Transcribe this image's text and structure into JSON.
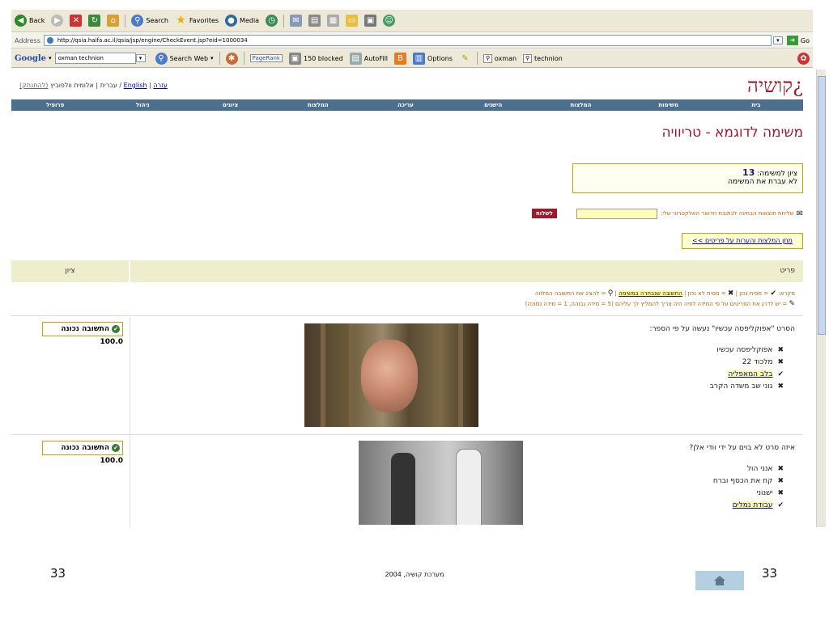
{
  "browser": {
    "back": "Back",
    "search": "Search",
    "favorites": "Favorites",
    "media": "Media",
    "address_label": "Address",
    "url": "http://qsia.haifa.ac.il/qsia/jsp/engine/CheckEvent.jsp?eid=1000034",
    "go": "Go",
    "google": "Google",
    "google_query": "oxman technion",
    "search_web": "Search Web",
    "pagerank": "PageRank",
    "blocked": "150 blocked",
    "autofill": "AutoFill",
    "options": "Options",
    "q1": "oxman",
    "q2": "technion"
  },
  "site": {
    "logo": "¿קושיה",
    "help": "עזרה",
    "english": "English",
    "lang_rest": "/ עברית",
    "user": "אלומית וולפוביץ",
    "logout": "(להתנתק)"
  },
  "nav": [
    "בית",
    "משימות",
    "המלצות",
    "הישגים",
    "עריכה",
    "המלצות",
    "ציונים",
    "ניהול",
    "פרופיל"
  ],
  "task": {
    "title": "משימה לדוגמא - טריוויה",
    "grade_label": "ציון למשימה:",
    "grade_value": "13",
    "status": "לא עברת את המשימה",
    "email_label": "שליחת תוצאות הבחינה לכתובת הדואר האלקטרוני שלי:",
    "send": "לשלוח",
    "recommend_link": "מתן המלצות והערות על פריטים >>"
  },
  "table": {
    "col_item": "פריט",
    "col_score": "ציון",
    "legend_1a": "מקרא:",
    "legend_1b": "= מסיח נכון |",
    "legend_1c": "= מסיח לא נכון |",
    "legend_1d": "התשובה שנבחרה במשימה",
    "legend_1e": "| ",
    "legend_1f": "= להציג את התשובה המלווה",
    "legend_2": "= יש לדרג את הפריטים על פי המידה לפיה היה צריך להמליץ לך עליהם (5 = מידה גבוהה, 1 = מידה נמוכה)"
  },
  "questions": [
    {
      "text": "הסרט \"אפוקליפסה עכשיו\" נעשה על פי הספר:",
      "options": [
        "אפוקליפסה עכשיו",
        "מלכוד 22",
        "בלב המאפליה",
        "גוני שב משדה הקרב"
      ],
      "marks": [
        "✖",
        "✖",
        "✔",
        "✖"
      ],
      "result": "התשובה נכונה",
      "score": "100.0"
    },
    {
      "text": "איזה סרט לא בוים על ידי וודי אלן?",
      "options": [
        "אנני הול",
        "קח את הכסף וברח",
        "ישנוני",
        "עבודת נמלים"
      ],
      "marks": [
        "✖",
        "✖",
        "✖",
        "✔"
      ],
      "result": "התשובה נכונה",
      "score": "100.0"
    }
  ],
  "slide_footer": {
    "left_num": "33",
    "center": "מערכת קושיה, 2004",
    "right_num": "33"
  }
}
